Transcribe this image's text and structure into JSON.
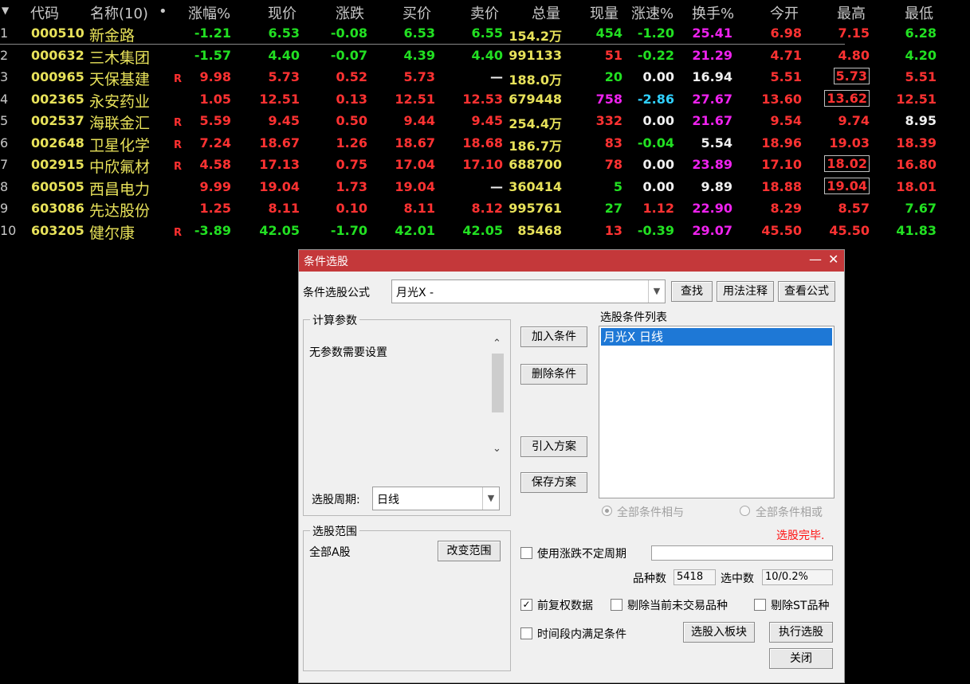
{
  "table": {
    "sort_dot": "•",
    "headers": [
      "代码",
      "名称(10)",
      "涨幅%",
      "现价",
      "涨跌",
      "买价",
      "卖价",
      "总量",
      "现量",
      "涨速%",
      "换手%",
      "今开",
      "最高",
      "最低"
    ],
    "rows": [
      {
        "idx": "1",
        "code": "000510",
        "name": "新金路",
        "r": "",
        "chg_pct": "-1.21",
        "price": "6.53",
        "chg": "-0.08",
        "bid": "6.53",
        "ask": "6.55",
        "vol": "154.2万",
        "cur_vol": "454",
        "speed": "-1.20",
        "turnover": "25.41",
        "open": "6.98",
        "high": "7.15",
        "low": "6.28"
      },
      {
        "idx": "2",
        "code": "000632",
        "name": "三木集团",
        "r": "",
        "chg_pct": "-1.57",
        "price": "4.40",
        "chg": "-0.07",
        "bid": "4.39",
        "ask": "4.40",
        "vol": "991133",
        "cur_vol": "51",
        "speed": "-0.22",
        "turnover": "21.29",
        "open": "4.71",
        "high": "4.80",
        "low": "4.20"
      },
      {
        "idx": "3",
        "code": "000965",
        "name": "天保基建",
        "r": "R",
        "chg_pct": "9.98",
        "price": "5.73",
        "chg": "0.52",
        "bid": "5.73",
        "ask": "—",
        "vol": "188.0万",
        "cur_vol": "20",
        "speed": "0.00",
        "turnover": "16.94",
        "open": "5.51",
        "high": "5.73",
        "low": "5.51"
      },
      {
        "idx": "4",
        "code": "002365",
        "name": "永安药业",
        "r": "",
        "chg_pct": "1.05",
        "price": "12.51",
        "chg": "0.13",
        "bid": "12.51",
        "ask": "12.53",
        "vol": "679448",
        "cur_vol": "758",
        "speed": "-2.86",
        "turnover": "27.67",
        "open": "13.60",
        "high": "13.62",
        "low": "12.51"
      },
      {
        "idx": "5",
        "code": "002537",
        "name": "海联金汇",
        "r": "R",
        "chg_pct": "5.59",
        "price": "9.45",
        "chg": "0.50",
        "bid": "9.44",
        "ask": "9.45",
        "vol": "254.4万",
        "cur_vol": "332",
        "speed": "0.00",
        "turnover": "21.67",
        "open": "9.54",
        "high": "9.74",
        "low": "8.95"
      },
      {
        "idx": "6",
        "code": "002648",
        "name": "卫星化学",
        "r": "R",
        "chg_pct": "7.24",
        "price": "18.67",
        "chg": "1.26",
        "bid": "18.67",
        "ask": "18.68",
        "vol": "186.7万",
        "cur_vol": "83",
        "speed": "-0.04",
        "turnover": "5.54",
        "open": "18.96",
        "high": "19.03",
        "low": "18.39"
      },
      {
        "idx": "7",
        "code": "002915",
        "name": "中欣氟材",
        "r": "R",
        "chg_pct": "4.58",
        "price": "17.13",
        "chg": "0.75",
        "bid": "17.04",
        "ask": "17.10",
        "vol": "688700",
        "cur_vol": "78",
        "speed": "0.00",
        "turnover": "23.89",
        "open": "17.10",
        "high": "18.02",
        "low": "16.80"
      },
      {
        "idx": "8",
        "code": "600505",
        "name": "西昌电力",
        "r": "",
        "chg_pct": "9.99",
        "price": "19.04",
        "chg": "1.73",
        "bid": "19.04",
        "ask": "—",
        "vol": "360414",
        "cur_vol": "5",
        "speed": "0.00",
        "turnover": "9.89",
        "open": "18.88",
        "high": "19.04",
        "low": "18.01"
      },
      {
        "idx": "9",
        "code": "603086",
        "name": "先达股份",
        "r": "",
        "chg_pct": "1.25",
        "price": "8.11",
        "chg": "0.10",
        "bid": "8.11",
        "ask": "8.12",
        "vol": "995761",
        "cur_vol": "27",
        "speed": "1.12",
        "turnover": "22.90",
        "open": "8.29",
        "high": "8.57",
        "low": "7.67"
      },
      {
        "idx": "10",
        "code": "603205",
        "name": "健尔康",
        "r": "R",
        "chg_pct": "-3.89",
        "price": "42.05",
        "chg": "-1.70",
        "bid": "42.01",
        "ask": "42.05",
        "vol": "85468",
        "cur_vol": "13",
        "speed": "-0.39",
        "turnover": "29.07",
        "open": "45.50",
        "high": "45.50",
        "low": "41.83"
      }
    ]
  },
  "dialog": {
    "title": "条件选股",
    "minimize": "—",
    "close": "✕",
    "formula_label": "条件选股公式",
    "formula_value": "月光X  -",
    "find_btn": "查找",
    "usage_btn": "用法注释",
    "view_btn": "查看公式",
    "params_group": "计算参数",
    "params_text": "无参数需要设置",
    "add_btn": "加入条件",
    "del_btn": "删除条件",
    "import_btn": "引入方案",
    "save_btn": "保存方案",
    "list_label": "选股条件列表",
    "list_item": "月光X  日线",
    "period_label": "选股周期:",
    "period_value": "日线",
    "all_and": "全部条件相与",
    "all_or": "全部条件相或",
    "done_text": "选股完毕.",
    "range_group": "选股范围",
    "range_value": "全部A股",
    "change_range_btn": "改变范围",
    "use_period_chk": "使用涨跌不定周期",
    "count_label": "品种数",
    "count_value": "5418",
    "selected_label": "选中数",
    "selected_value": "10/0.2%",
    "fq_chk": "前复权数据",
    "exclude_nontrade_chk": "剔除当前未交易品种",
    "exclude_st_chk": "剔除ST品种",
    "timerange_chk": "时间段内满足条件",
    "to_block_btn": "选股入板块",
    "exec_btn": "执行选股",
    "close_btn": "关闭",
    "check_mark": "✓",
    "arrow_up": "⌃",
    "arrow_down": "⌄",
    "dd_arrow": "▼"
  }
}
